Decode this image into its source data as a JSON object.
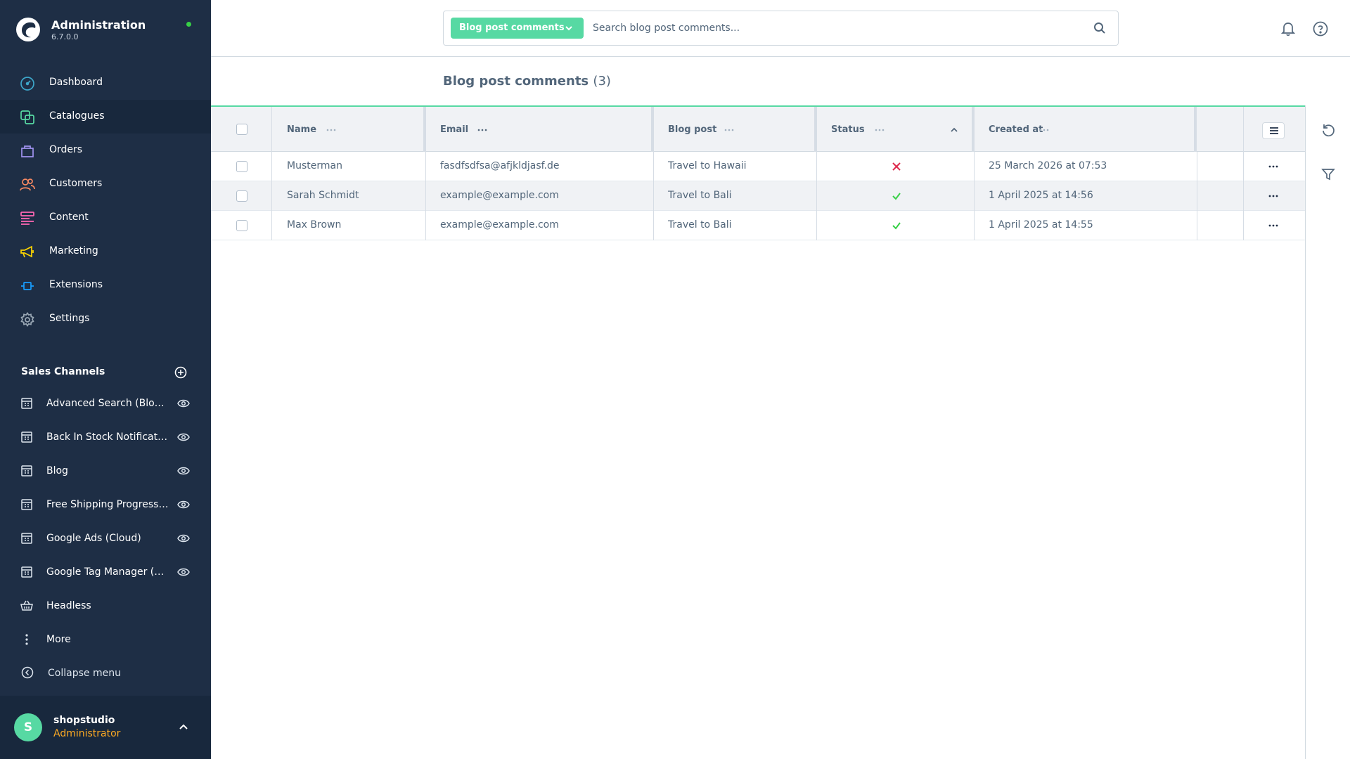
{
  "brand": {
    "name": "Administration",
    "version": "6.7.0.0",
    "status_color": "#37d046"
  },
  "nav": [
    {
      "id": "dashboard",
      "label": "Dashboard",
      "icon": "dashboard-icon",
      "color": "#3da6c9"
    },
    {
      "id": "catalogues",
      "label": "Catalogues",
      "icon": "catalogues-icon",
      "color": "#57d9a3",
      "active": true
    },
    {
      "id": "orders",
      "label": "Orders",
      "icon": "orders-icon",
      "color": "#a092f0"
    },
    {
      "id": "customers",
      "label": "Customers",
      "icon": "customers-icon",
      "color": "#f88962"
    },
    {
      "id": "content",
      "label": "Content",
      "icon": "content-icon",
      "color": "#ff68b4"
    },
    {
      "id": "marketing",
      "label": "Marketing",
      "icon": "marketing-icon",
      "color": "#ffd700"
    },
    {
      "id": "extensions",
      "label": "Extensions",
      "icon": "extensions-icon",
      "color": "#189eff"
    },
    {
      "id": "settings",
      "label": "Settings",
      "icon": "settings-icon",
      "color": "#9aa8b5"
    }
  ],
  "sales_channels": {
    "title": "Sales Channels",
    "items": [
      {
        "label": "Advanced Search (Blog ...",
        "icon": "storefront-icon"
      },
      {
        "label": "Back In Stock Notificati...",
        "icon": "storefront-icon"
      },
      {
        "label": "Blog",
        "icon": "storefront-icon"
      },
      {
        "label": "Free Shipping Progress ...",
        "icon": "storefront-icon"
      },
      {
        "label": "Google Ads (Cloud)",
        "icon": "storefront-icon"
      },
      {
        "label": "Google Tag Manager (C...",
        "icon": "storefront-icon"
      },
      {
        "label": "Headless",
        "icon": "basket-icon"
      },
      {
        "label": "More",
        "icon": "more-vertical-icon"
      }
    ]
  },
  "collapse_label": "Collapse menu",
  "user": {
    "initial": "S",
    "name": "shopstudio",
    "role": "Administrator"
  },
  "search": {
    "type_label": "Blog post comments",
    "placeholder": "Search blog post comments...",
    "value": ""
  },
  "page": {
    "title": "Blog post comments",
    "count": "(3)"
  },
  "grid": {
    "columns": {
      "name": "Name",
      "email": "Email",
      "blog_post": "Blog post",
      "status": "Status",
      "created_at": "Created at"
    },
    "rows": [
      {
        "name": "Musterman",
        "email": "fasdfsdfsa@afjkldjasf.de",
        "blog_post": "Travel to Hawaii",
        "status": "inactive",
        "created_at": "25 March 2026 at 07:53"
      },
      {
        "name": "Sarah Schmidt",
        "email": "example@example.com",
        "blog_post": "Travel to Bali",
        "status": "active",
        "created_at": "1 April 2025 at 14:56"
      },
      {
        "name": "Max Brown",
        "email": "example@example.com",
        "blog_post": "Travel to Bali",
        "status": "active",
        "created_at": "1 April 2025 at 14:55"
      }
    ]
  },
  "colors": {
    "accent": "#57d9a3",
    "sidebar_bg": "#1e2e45",
    "danger": "#de294c",
    "success": "#37d046",
    "warning": "#ffab22"
  }
}
